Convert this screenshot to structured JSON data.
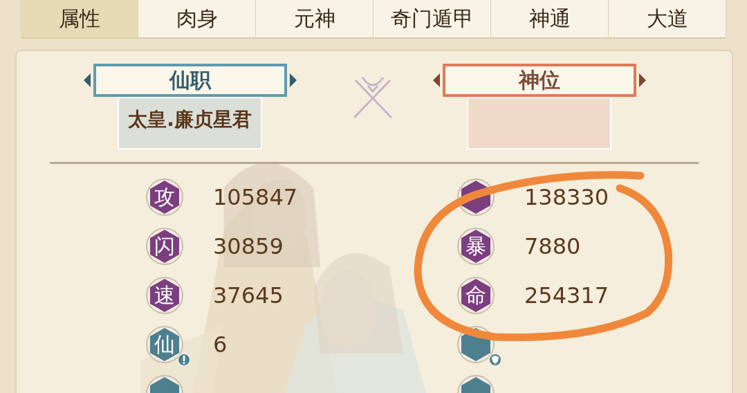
{
  "tabs": [
    {
      "label": "属性",
      "selected": true
    },
    {
      "label": "肉身",
      "selected": false
    },
    {
      "label": "元神",
      "selected": false
    },
    {
      "label": "奇门遁甲",
      "selected": false
    },
    {
      "label": "神通",
      "selected": false
    },
    {
      "label": "大道",
      "selected": false
    }
  ],
  "titles": [
    {
      "label": "仙职",
      "color": "#5f9bb0",
      "value": "太皇.廉贞星君"
    },
    {
      "label": "神位",
      "color": "#e07a5a"
    }
  ],
  "stats": [
    {
      "icon": "攻",
      "color": "#7b3f80",
      "kind": "plain",
      "value": "105847"
    },
    {
      "color": "#7b3f80",
      "kind": "plain",
      "value": "138330"
    },
    {
      "icon": "闪",
      "color": "#7b3f80",
      "kind": "plain",
      "value": "30859"
    },
    {
      "icon": "暴",
      "color": "#7b3f80",
      "kind": "plain",
      "value": "7880"
    },
    {
      "icon": "速",
      "color": "#7b3f80",
      "kind": "plain",
      "value": "37645"
    },
    {
      "icon": "命",
      "color": "#7b3f80",
      "kind": "plain",
      "value": "254317"
    },
    {
      "icon": "仙",
      "color": "#4d7f8e",
      "kind": "alert",
      "value": "6"
    },
    {
      "color": "#4d7f8e",
      "kind": "shield"
    },
    {
      "color": "#4d7f8e",
      "kind": "plain"
    },
    {
      "color": "#4d7f8e",
      "kind": "plain"
    }
  ],
  "annotation": {
    "kind": "hand-drawn-circle"
  }
}
